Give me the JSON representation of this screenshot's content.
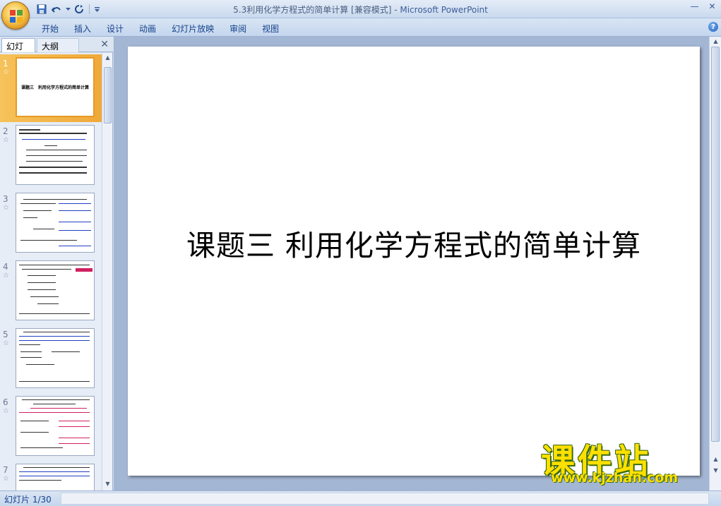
{
  "window": {
    "title": "5.3利用化学方程式的简单计算 [兼容模式]",
    "title_sep": " - ",
    "app_name": "Microsoft PowerPoint",
    "min_label": "—",
    "close_label": "✕"
  },
  "ribbon": {
    "tabs": [
      "开始",
      "插入",
      "设计",
      "动画",
      "幻灯片放映",
      "审阅",
      "视图"
    ],
    "help_label": "?"
  },
  "left_panel": {
    "tabs": [
      "幻灯片",
      "大纲"
    ],
    "close_label": "✕",
    "thumbnails": [
      {
        "number": "1",
        "star": "☆",
        "caption": "课题三　利用化学方程式的简单计算"
      },
      {
        "number": "2",
        "star": "☆"
      },
      {
        "number": "3",
        "star": "☆"
      },
      {
        "number": "4",
        "star": "☆"
      },
      {
        "number": "5",
        "star": "☆"
      },
      {
        "number": "6",
        "star": "☆"
      },
      {
        "number": "7",
        "star": "☆"
      }
    ]
  },
  "slide": {
    "title": "课题三  利用化学方程式的简单计算"
  },
  "watermark": {
    "text": "课件站",
    "url": "www.kjzhan.com"
  },
  "status": {
    "slide_indicator": "幻灯片 1/30"
  },
  "colors": {
    "selected_thumb": "#f0a93a",
    "watermark": "#ffe000",
    "slide_bg": "#ffffff",
    "workspace_bg": "#a3b6d3"
  }
}
